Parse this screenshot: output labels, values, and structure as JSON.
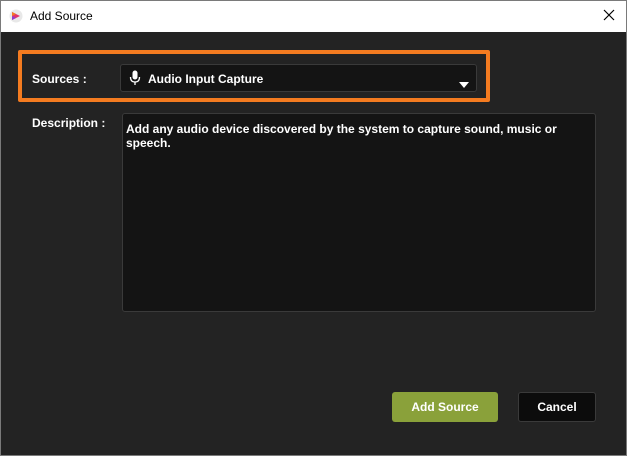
{
  "window": {
    "title": "Add Source",
    "close_icon": "close-icon",
    "app_icon": "app-logo-icon"
  },
  "form": {
    "sources_label": "Sources :",
    "sources_value": "Audio Input Capture",
    "sources_icon": "microphone-icon",
    "description_label": "Description :",
    "description_text": "Add any audio device discovered by the system to capture sound, music or speech."
  },
  "buttons": {
    "add_label": "Add Source",
    "cancel_label": "Cancel"
  },
  "colors": {
    "background": "#232323",
    "highlight": "#f47b20",
    "accent": "#8aa13a",
    "field": "#141414"
  }
}
